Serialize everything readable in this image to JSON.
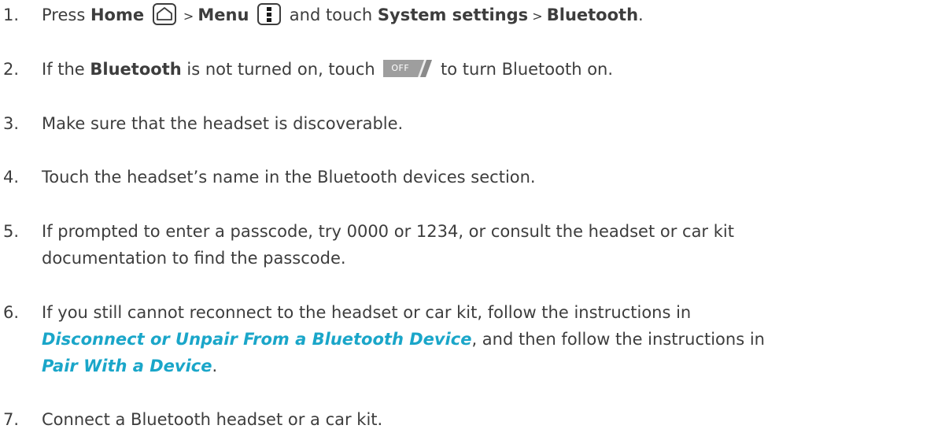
{
  "steps": [
    {
      "number": "1.",
      "p1": "Press ",
      "home": "Home",
      "p2": " > ",
      "menu": "Menu",
      "p3": " and touch ",
      "sys": "System settings",
      "p4": " > ",
      "bt": "Bluetooth",
      "p5": ".",
      "home_icon": "home-icon",
      "menu_icon": "menu-icon"
    },
    {
      "number": "2.",
      "p1": "If the ",
      "bt": "Bluetooth",
      "p2": " is not turned on, touch ",
      "off_label": "OFF",
      "p3": " to turn Bluetooth on."
    },
    {
      "number": "3.",
      "text": "Make sure that the headset is discoverable."
    },
    {
      "number": "4.",
      "text": "Touch the headset’s name in the Bluetooth devices section."
    },
    {
      "number": "5.",
      "line1": "If prompted to enter a passcode, try 0000 or 1234, or consult the headset or car kit",
      "line2": "documentation to find the passcode."
    },
    {
      "number": "6.",
      "line1": "If you still cannot reconnect to the headset or car kit, follow the instructions in",
      "link1": "Disconnect or Unpair From a Bluetooth Device",
      "mid": ", and then follow the instructions in",
      "link2": "Pair With a Device",
      "end": "."
    },
    {
      "number": "7.",
      "text": "Connect a Bluetooth headset or a car kit."
    }
  ],
  "colors": {
    "text": "#3d3d3d",
    "link": "#1aa6c9",
    "off_button": "#9e9e9e"
  }
}
